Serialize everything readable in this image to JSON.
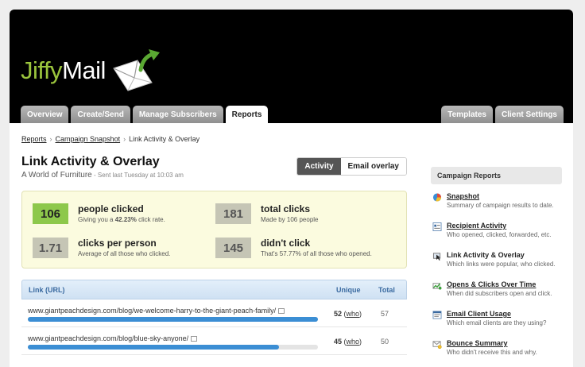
{
  "brand": {
    "part1": "Jiffy",
    "part2": "Mail"
  },
  "tabs_left": [
    "Overview",
    "Create/Send",
    "Manage Subscribers",
    "Reports"
  ],
  "tabs_right": [
    "Templates",
    "Client Settings"
  ],
  "breadcrumb": {
    "root": "Reports",
    "parent": "Campaign Snapshot",
    "current": "Link Activity & Overlay"
  },
  "page": {
    "title": "Link Activity & Overlay",
    "campaign": "A World of Furniture",
    "sent": " - Sent last Tuesday at 10:03 am",
    "toggle_on": "Activity",
    "toggle_off": "Email overlay"
  },
  "stats": {
    "clicked": {
      "value": "106",
      "label": "people clicked",
      "desc_pre": "Giving you a ",
      "desc_rate": "42.23%",
      "desc_post": " click rate."
    },
    "total": {
      "value": "181",
      "label": "total clicks",
      "desc": "Made by 106 people"
    },
    "per_person": {
      "value": "1.71",
      "label": "clicks per person",
      "desc": "Average of all those who clicked."
    },
    "didnt": {
      "value": "145",
      "label": "didn't click",
      "desc": "That's 57.77% of all those who opened."
    }
  },
  "table": {
    "headers": {
      "link": "Link (URL)",
      "unique": "Unique",
      "total": "Total"
    },
    "rows": [
      {
        "url": "www.giantpeachdesign.com/blog/we-welcome-harry-to-the-giant-peach-family/",
        "unique": "52",
        "who": "who",
        "total": "57",
        "fill": 1.0
      },
      {
        "url": "www.giantpeachdesign.com/blog/blue-sky-anyone/",
        "unique": "45",
        "who": "who",
        "total": "50",
        "fill": 0.865
      }
    ]
  },
  "sidebar": {
    "heading": "Campaign Reports",
    "items": [
      {
        "title": "Snapshot",
        "desc": "Summary of campaign results to date.",
        "icon": "pie-chart-icon"
      },
      {
        "title": "Recipient Activity",
        "desc": "Who opened, clicked, forwarded, etc.",
        "icon": "recipient-list-icon"
      },
      {
        "title": "Link Activity & Overlay",
        "desc": "Which links were popular, who clicked.",
        "icon": "link-activity-icon"
      },
      {
        "title": "Opens & Clicks Over Time",
        "desc": "When did subscribers open and click.",
        "icon": "opens-chart-icon"
      },
      {
        "title": "Email Client Usage",
        "desc": "Which email clients are they using?",
        "icon": "email-client-icon"
      },
      {
        "title": "Bounce Summary",
        "desc": "Who didn't receive this and why.",
        "icon": "bounce-icon"
      }
    ]
  },
  "colors": {
    "accent_green": "#8dc84b",
    "bar_blue": "#3b8ed4",
    "brand_green": "#9bc53d"
  }
}
